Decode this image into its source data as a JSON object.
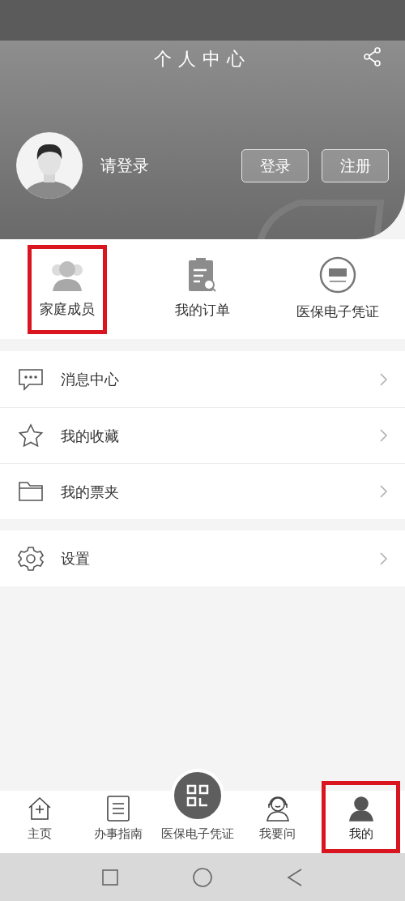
{
  "header": {
    "title": "个人中心",
    "user_prompt": "请登录",
    "buttons": [
      "登录",
      "注册"
    ]
  },
  "quick_items": [
    {
      "kind": "family",
      "label": "家庭成员",
      "highlighted": true
    },
    {
      "kind": "orders",
      "label": "我的订单",
      "highlighted": false
    },
    {
      "kind": "certificate",
      "label": "医保电子凭证",
      "highlighted": false
    }
  ],
  "menu_groups": [
    [
      {
        "kind": "message",
        "label": "消息中心"
      },
      {
        "kind": "favorite",
        "label": "我的收藏"
      },
      {
        "kind": "folder",
        "label": "我的票夹"
      }
    ],
    [
      {
        "kind": "settings",
        "label": "设置"
      }
    ]
  ],
  "tab_bar": [
    {
      "kind": "home",
      "label": "主页",
      "selected": false,
      "highlighted": false
    },
    {
      "kind": "guide",
      "label": "办事指南",
      "selected": false,
      "highlighted": false
    },
    {
      "kind": "qr",
      "label": "医保电子凭证",
      "selected": false,
      "highlighted": false
    },
    {
      "kind": "ask",
      "label": "我要问",
      "selected": false,
      "highlighted": false
    },
    {
      "kind": "me",
      "label": "我的",
      "selected": true,
      "highlighted": true
    }
  ]
}
